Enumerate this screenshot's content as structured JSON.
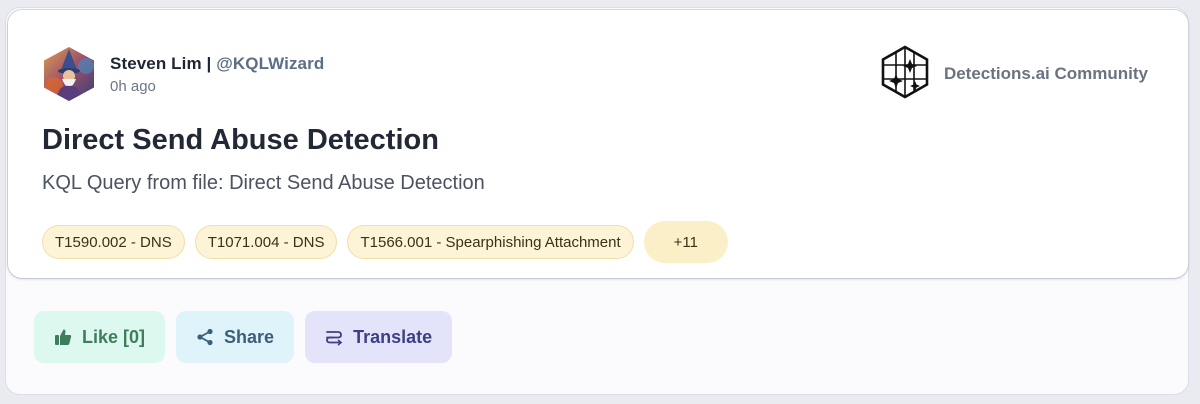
{
  "post": {
    "author_name": "Steven Lim | ",
    "author_handle": "@KQLWizard",
    "time_ago": "0h ago",
    "community_name": "Detections.ai Community",
    "title": "Direct Send Abuse Detection",
    "subtitle": "KQL Query from file: Direct Send Abuse Detection",
    "tags": [
      "T1590.002 - DNS",
      "T1071.004 - DNS",
      "T1566.001 - Spearphishing Attachment"
    ],
    "more_tags": "+11"
  },
  "actions": {
    "like_label": "Like [0]",
    "share_label": "Share",
    "translate_label": "Translate"
  },
  "icons": {
    "like": "thumbs-up-icon",
    "share": "share-icon",
    "translate": "translate-icon",
    "community": "detections-logo-icon"
  },
  "colors": {
    "tag_bg": "#fdf4d8",
    "like_bg": "#ddf8ef",
    "share_bg": "#dff4fa",
    "translate_bg": "#e3e4fa"
  }
}
